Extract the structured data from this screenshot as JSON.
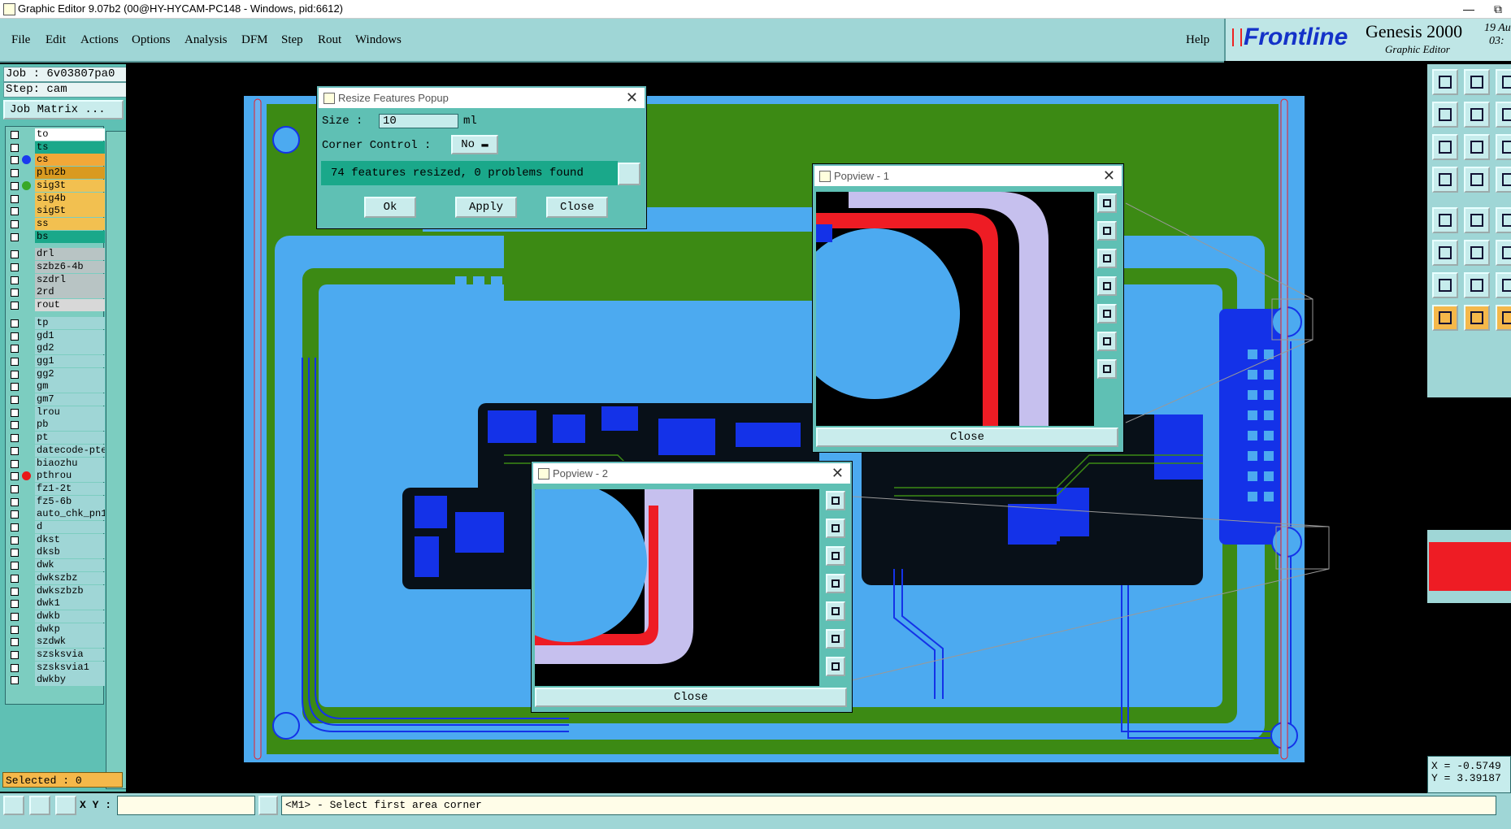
{
  "window": {
    "title": "Graphic Editor 9.07b2 (00@HY-HYCAM-PC148 - Windows, pid:6612)"
  },
  "menu": [
    "File",
    "Edit",
    "Actions",
    "Options",
    "Analysis",
    "DFM",
    "Step",
    "Rout",
    "Windows"
  ],
  "help": "Help",
  "brand": {
    "logo": "Frontline",
    "product": "Genesis 2000",
    "subtitle": "Graphic Editor",
    "date": "19 Au",
    "time": "03:"
  },
  "job": {
    "job_line": "Job : 6v03807pa0",
    "step_line": "Step: cam",
    "matrix_button": "Job Matrix ..."
  },
  "layers": [
    {
      "name": "to",
      "color": "#ffffff"
    },
    {
      "name": "ts",
      "color": "#1aa88a"
    },
    {
      "name": "cs",
      "color": "#f2a838",
      "dot": "#1a3aee"
    },
    {
      "name": "pln2b",
      "color": "#d99a20"
    },
    {
      "name": "sig3t",
      "color": "#f2c050",
      "dot": "#38a826"
    },
    {
      "name": "sig4b",
      "color": "#f2c050"
    },
    {
      "name": "sig5t",
      "color": "#f2c050"
    },
    {
      "name": "ss",
      "color": "#f2c050"
    },
    {
      "name": "bs",
      "color": "#1aa88a"
    },
    {
      "name": "drl",
      "color": "#b8c4c4"
    },
    {
      "name": "szbz6-4b",
      "color": "#b8c4c4"
    },
    {
      "name": "szdrl",
      "color": "#b8c4c4"
    },
    {
      "name": "2rd",
      "color": "#b8c4c4"
    },
    {
      "name": "rout",
      "color": "#d8d8d8"
    },
    {
      "name": "tp",
      "color": "#9fd6d6"
    },
    {
      "name": "gd1",
      "color": "#9fd6d6"
    },
    {
      "name": "gd2",
      "color": "#9fd6d6"
    },
    {
      "name": "gg1",
      "color": "#9fd6d6"
    },
    {
      "name": "gg2",
      "color": "#9fd6d6"
    },
    {
      "name": "gm",
      "color": "#9fd6d6"
    },
    {
      "name": "gm7",
      "color": "#9fd6d6"
    },
    {
      "name": "lrou",
      "color": "#9fd6d6"
    },
    {
      "name": "pb",
      "color": "#9fd6d6"
    },
    {
      "name": "pt",
      "color": "#9fd6d6"
    },
    {
      "name": "datecode-pte",
      "color": "#9fd6d6"
    },
    {
      "name": "biaozhu",
      "color": "#9fd6d6"
    },
    {
      "name": "pthrou",
      "color": "#9fd6d6",
      "dot": "#e81818"
    },
    {
      "name": "fz1-2t",
      "color": "#9fd6d6"
    },
    {
      "name": "fz5-6b",
      "color": "#9fd6d6"
    },
    {
      "name": "auto_chk_pn1",
      "color": "#9fd6d6"
    },
    {
      "name": "d",
      "color": "#9fd6d6"
    },
    {
      "name": "dkst",
      "color": "#9fd6d6"
    },
    {
      "name": "dksb",
      "color": "#9fd6d6"
    },
    {
      "name": "dwk",
      "color": "#9fd6d6"
    },
    {
      "name": "dwkszbz",
      "color": "#9fd6d6"
    },
    {
      "name": "dwkszbzb",
      "color": "#9fd6d6"
    },
    {
      "name": "dwk1",
      "color": "#9fd6d6"
    },
    {
      "name": "dwkb",
      "color": "#9fd6d6"
    },
    {
      "name": "dwkp",
      "color": "#9fd6d6"
    },
    {
      "name": "szdwk",
      "color": "#9fd6d6"
    },
    {
      "name": "szsksvia",
      "color": "#9fd6d6"
    },
    {
      "name": "szsksvia1",
      "color": "#9fd6d6"
    },
    {
      "name": "dwkby",
      "color": "#9fd6d6"
    }
  ],
  "selected": "Selected : 0",
  "status": {
    "xy_label": "X Y :",
    "xy_value": "",
    "prompt": "<M1> - Select first area corner"
  },
  "coords": {
    "x": "X = -0.5749",
    "y": "Y = 3.39187"
  },
  "resize": {
    "title": "Resize Features Popup",
    "size_label": "Size :",
    "size_value": "10",
    "unit": "ml",
    "corner_label": "Corner Control :",
    "corner_value": "No",
    "message": "74 features resized, 0 problems found",
    "ok": "Ok",
    "apply": "Apply",
    "close": "Close"
  },
  "popview1": {
    "title": "Popview - 1",
    "close": "Close"
  },
  "popview2": {
    "title": "Popview - 2",
    "close": "Close"
  },
  "colors": {
    "copper": "#4caaf0",
    "green": "#3c8a14",
    "trace_blue": "#1432e8",
    "red": "#ee1c24",
    "panel": "#5fc0b4"
  }
}
